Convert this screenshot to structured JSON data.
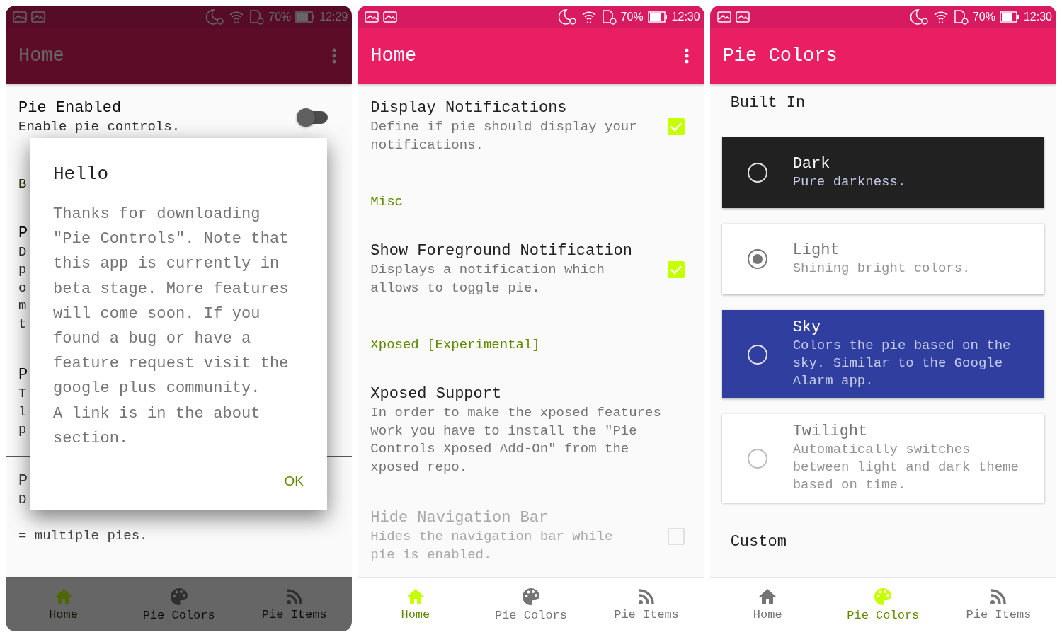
{
  "screens": [
    {
      "kind": "settings",
      "dimmed": true,
      "status_bar": {
        "battery": "70%",
        "time": "12:29"
      },
      "app_bar": {
        "title": "Home"
      },
      "items": [
        {
          "kind": "switch",
          "title": "Pie Enabled",
          "summary": "Enable pie controls.",
          "checked": false,
          "disabled": false
        },
        {
          "kind": "header",
          "title": "B"
        },
        {
          "kind": "plain",
          "title": "P",
          "summary": "D\np\no\nm\nt",
          "disabled": false
        },
        {
          "kind": "plain",
          "title": "P",
          "summary": "T\nl\np",
          "disabled": false
        },
        {
          "kind": "plain",
          "title": "P",
          "summary": "D\n\n= multiple pies.",
          "disabled": true
        }
      ],
      "dialog": {
        "title": "Hello",
        "paragraphs": [
          "Thanks for downloading \"Pie Controls\". Note that this app is currently in beta stage. More features will come soon. If you found a bug or have a feature request visit the google plus community.",
          "A link is in the about section."
        ],
        "button": "OK"
      },
      "bottom_nav": [
        {
          "label": "Home",
          "selected": true
        },
        {
          "label": "Pie Colors",
          "selected": false
        },
        {
          "label": "Pie Items",
          "selected": false
        }
      ]
    },
    {
      "kind": "settings",
      "dimmed": false,
      "status_bar": {
        "battery": "70%",
        "time": "12:30"
      },
      "app_bar": {
        "title": "Home"
      },
      "items": [
        {
          "kind": "checkbox",
          "title": "Display Notifications",
          "summary": "Define if pie should display your\nnotifications.",
          "checked": true,
          "disabled": false
        },
        {
          "kind": "header",
          "title": "Misc"
        },
        {
          "kind": "checkbox",
          "title": "Show Foreground Notification",
          "summary": "Displays a notification which\nallows to toggle pie.",
          "checked": true,
          "disabled": false
        },
        {
          "kind": "header",
          "title": "Xposed [Experimental]"
        },
        {
          "kind": "plain",
          "title": "Xposed Support",
          "summary": "In order to make the xposed features\nwork you have to install the \"Pie\nControls Xposed Add-On\" from the\nxposed repo.",
          "disabled": false
        },
        {
          "kind": "checkbox",
          "title": "Hide Navigation Bar",
          "summary": "Hides the navigation bar while\npie is enabled.",
          "checked": false,
          "disabled": true
        }
      ],
      "bottom_nav": [
        {
          "label": "Home",
          "selected": true
        },
        {
          "label": "Pie Colors",
          "selected": false
        },
        {
          "label": "Pie Items",
          "selected": false
        }
      ]
    },
    {
      "kind": "colors",
      "dimmed": false,
      "status_bar": {
        "battery": "70%",
        "time": "12:30"
      },
      "app_bar": {
        "title": "Pie Colors"
      },
      "sections": [
        {
          "title": "Built In",
          "themes": [
            {
              "name": "Dark",
              "description": "Pure darkness.",
              "color": "#212121",
              "selected": false
            },
            {
              "name": "Light",
              "description": "Shining bright colors.",
              "color": "#ffffff",
              "selected": true
            },
            {
              "name": "Sky",
              "description": "Colors the pie based on the\nsky. Similar to the Google\nAlarm app.",
              "color": "#303f9f",
              "selected": false
            },
            {
              "name": "Twilight",
              "description": "Automatically switches\nbetween light and dark theme\nbased on time.",
              "color": "#ffffff",
              "selected": false
            }
          ]
        },
        {
          "title": "Custom"
        }
      ],
      "bottom_nav": [
        {
          "label": "Home",
          "selected": false
        },
        {
          "label": "Pie Colors",
          "selected": true
        },
        {
          "label": "Pie Items",
          "selected": false
        }
      ]
    }
  ]
}
